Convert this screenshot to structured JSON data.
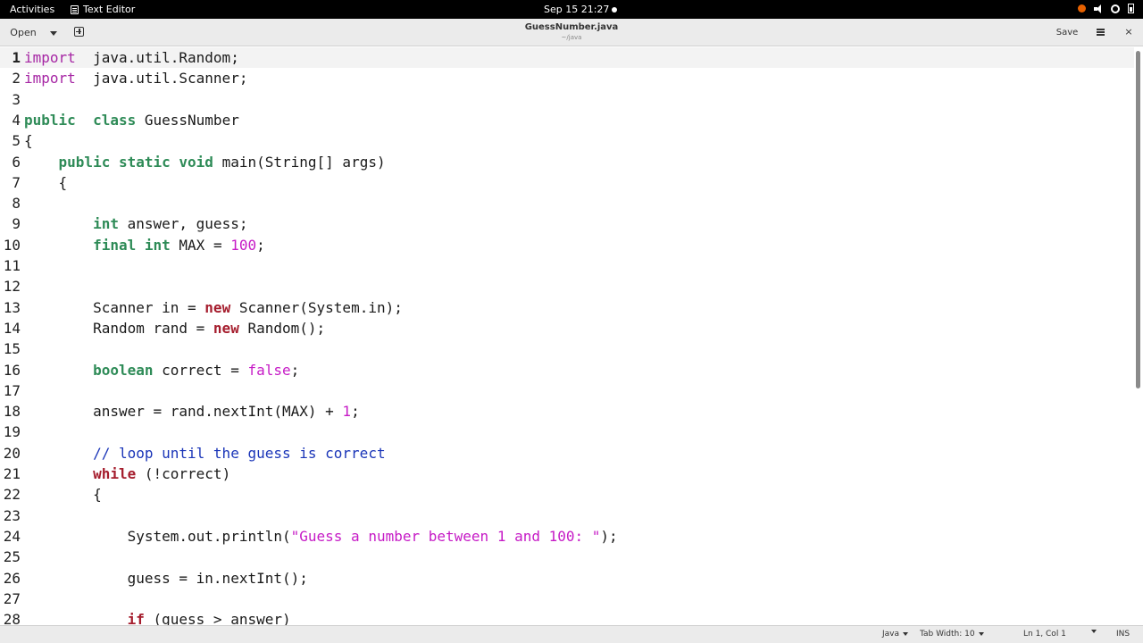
{
  "topbar": {
    "activities": "Activities",
    "app_name": "Text Editor",
    "clock": "Sep 15  21:27"
  },
  "header": {
    "open_label": "Open",
    "title": "GuessNumber.java",
    "subtitle": "~/java",
    "save_label": "Save",
    "close_glyph": "×"
  },
  "editor": {
    "current_line": 1,
    "lines": [
      {
        "n": "1",
        "segs": [
          [
            "kw-import",
            "import"
          ],
          [
            "",
            "  java.util.Random;"
          ]
        ]
      },
      {
        "n": "2",
        "segs": [
          [
            "kw-import",
            "import"
          ],
          [
            "",
            "  java.util.Scanner;"
          ]
        ]
      },
      {
        "n": "3",
        "segs": []
      },
      {
        "n": "4",
        "segs": [
          [
            "kw",
            "public"
          ],
          [
            "",
            "  "
          ],
          [
            "kw",
            "class"
          ],
          [
            "",
            " GuessNumber"
          ]
        ]
      },
      {
        "n": "5",
        "segs": [
          [
            "",
            "{"
          ]
        ]
      },
      {
        "n": "6",
        "segs": [
          [
            "",
            "    "
          ],
          [
            "kw",
            "public"
          ],
          [
            "",
            " "
          ],
          [
            "kw",
            "static"
          ],
          [
            "",
            " "
          ],
          [
            "kw",
            "void"
          ],
          [
            "",
            " main(String[] args)"
          ]
        ]
      },
      {
        "n": "7",
        "segs": [
          [
            "",
            "    {"
          ]
        ]
      },
      {
        "n": "8",
        "segs": []
      },
      {
        "n": "9",
        "segs": [
          [
            "",
            "        "
          ],
          [
            "kw",
            "int"
          ],
          [
            "",
            " answer, guess;"
          ]
        ]
      },
      {
        "n": "10",
        "segs": [
          [
            "",
            "        "
          ],
          [
            "kw",
            "final"
          ],
          [
            "",
            " "
          ],
          [
            "kw",
            "int"
          ],
          [
            "",
            " MAX = "
          ],
          [
            "num",
            "100"
          ],
          [
            "",
            ";"
          ]
        ]
      },
      {
        "n": "11",
        "segs": []
      },
      {
        "n": "12",
        "segs": []
      },
      {
        "n": "13",
        "segs": [
          [
            "",
            "        Scanner in = "
          ],
          [
            "kw-red",
            "new"
          ],
          [
            "",
            " Scanner(System.in);"
          ]
        ]
      },
      {
        "n": "14",
        "segs": [
          [
            "",
            "        Random rand = "
          ],
          [
            "kw-red",
            "new"
          ],
          [
            "",
            " Random();"
          ]
        ]
      },
      {
        "n": "15",
        "segs": []
      },
      {
        "n": "16",
        "segs": [
          [
            "",
            "        "
          ],
          [
            "kw",
            "boolean"
          ],
          [
            "",
            " correct = "
          ],
          [
            "num",
            "false"
          ],
          [
            "",
            ";"
          ]
        ]
      },
      {
        "n": "17",
        "segs": []
      },
      {
        "n": "18",
        "segs": [
          [
            "",
            "        answer = rand.nextInt(MAX) + "
          ],
          [
            "num",
            "1"
          ],
          [
            "",
            ";"
          ]
        ]
      },
      {
        "n": "19",
        "segs": []
      },
      {
        "n": "20",
        "segs": [
          [
            "",
            "        "
          ],
          [
            "cmt",
            "// loop until the guess is correct"
          ]
        ]
      },
      {
        "n": "21",
        "segs": [
          [
            "",
            "        "
          ],
          [
            "kw-red",
            "while"
          ],
          [
            "",
            " (!correct)"
          ]
        ]
      },
      {
        "n": "22",
        "segs": [
          [
            "",
            "        {"
          ]
        ]
      },
      {
        "n": "23",
        "segs": []
      },
      {
        "n": "24",
        "segs": [
          [
            "",
            "            System.out.println("
          ],
          [
            "str",
            "\"Guess a number between 1 and 100: \""
          ],
          [
            "",
            ");"
          ]
        ]
      },
      {
        "n": "25",
        "segs": []
      },
      {
        "n": "26",
        "segs": [
          [
            "",
            "            guess = in.nextInt();"
          ]
        ]
      },
      {
        "n": "27",
        "segs": []
      },
      {
        "n": "28",
        "segs": [
          [
            "",
            "            "
          ],
          [
            "kw-red",
            "if"
          ],
          [
            "",
            " (guess > answer)"
          ]
        ]
      }
    ]
  },
  "statusbar": {
    "language": "Java",
    "tab_width": "Tab Width: 10",
    "position": "Ln 1, Col 1",
    "mode": "INS"
  },
  "colors": {
    "keyword_green": "#2e8b57",
    "keyword_red": "#a51d2d",
    "import_purple": "#a626a4",
    "literal_magenta": "#c61bc6",
    "comment_blue": "#1a35b8"
  }
}
